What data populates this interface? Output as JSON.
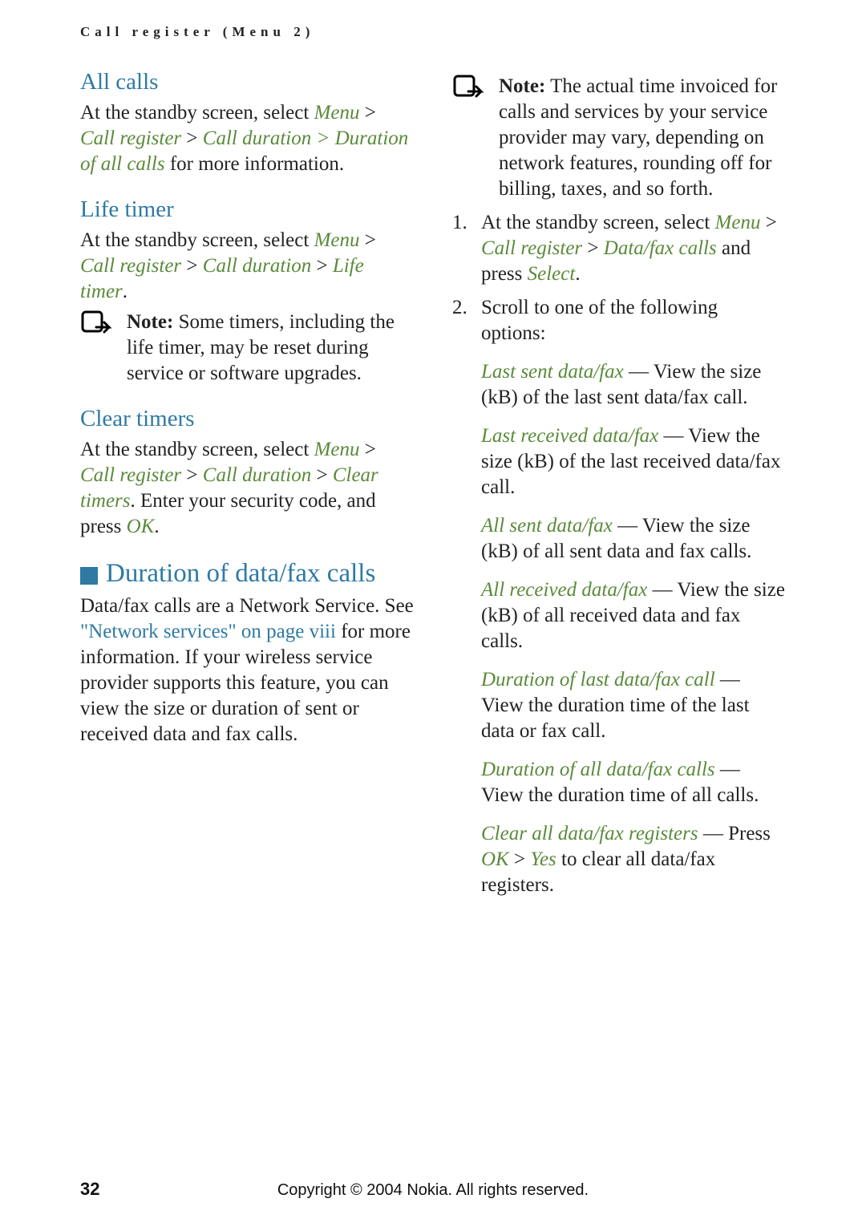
{
  "header_runner": "Call register (Menu 2)",
  "left": {
    "all_calls": {
      "heading": "All calls",
      "p_before": "At the standby screen, select ",
      "g1": "Menu",
      "sep1": " > ",
      "g2": "Call register",
      "sep2": " > ",
      "g3": "Call duration",
      "sep3": " > ",
      "g4": "Duration of all calls",
      "p_after": " for more information."
    },
    "life_timer": {
      "heading": "Life timer",
      "p_before": "At the standby screen, select ",
      "g1": "Menu",
      "sep1": " > ",
      "g2": "Call register",
      "sep2": " > ",
      "g3": "Call duration",
      "sep3": " > ",
      "g4": "Life timer",
      "period": ".",
      "note_label": "Note:",
      "note_text": " Some timers, including the life timer, may be reset during service or software upgrades."
    },
    "clear_timers": {
      "heading": "Clear timers",
      "p_before": "At the standby screen, select ",
      "g1": "Menu",
      "sep1": " > ",
      "g2": "Call register",
      "sep2": " > ",
      "g3": "Call duration",
      "sep3": " > ",
      "g4": "Clear timers",
      "p_mid": ". Enter your security code, and press ",
      "g5": "OK",
      "period": "."
    },
    "duration_section": {
      "heading": "Duration of data/fax calls",
      "p_before": "Data/fax calls are a Network Service. See ",
      "link": "\"Network services\" on page viii",
      "p_after": " for more information. If your wireless service provider supports this feature, you can view the size or duration of sent or received data and fax calls."
    }
  },
  "right": {
    "note_label": "Note:",
    "note_text": " The actual time invoiced for calls and services by your service provider may vary, depending on network features, rounding off for billing, taxes, and so forth.",
    "step1_before": "At the standby screen, select ",
    "step1_g1": "Menu",
    "step1_sep1": " > ",
    "step1_g2": "Call register",
    "step1_sep2": " > ",
    "step1_g3": "Data/fax calls",
    "step1_mid": " and press ",
    "step1_g4": "Select",
    "step1_period": ".",
    "step2": "Scroll to one of the following options:",
    "opt1_g": "Last sent data/fax",
    "opt1_t": " — View the size (kB) of the last sent data/fax call.",
    "opt2_g": "Last received data/fax",
    "opt2_t": " — View the size (kB) of the last received data/fax call.",
    "opt3_g": "All sent data/fax",
    "opt3_t": " — View the size (kB) of all sent data and fax calls.",
    "opt4_g": "All received data/fax",
    "opt4_t": " — View the size (kB) of all received data and fax calls.",
    "opt5_g": "Duration of last data/fax call",
    "opt5_t": " — View the duration time of the last data or fax call.",
    "opt6_g": "Duration of all data/fax calls",
    "opt6_t": " — View the duration time of all calls.",
    "opt7_g": "Clear all data/fax registers",
    "opt7_t1": " — Press ",
    "opt7_g2": "OK",
    "opt7_sep": " > ",
    "opt7_g3": "Yes",
    "opt7_t2": " to clear all data/fax registers."
  },
  "footer": {
    "page": "32",
    "copyright": "Copyright © 2004 Nokia. All rights reserved."
  }
}
